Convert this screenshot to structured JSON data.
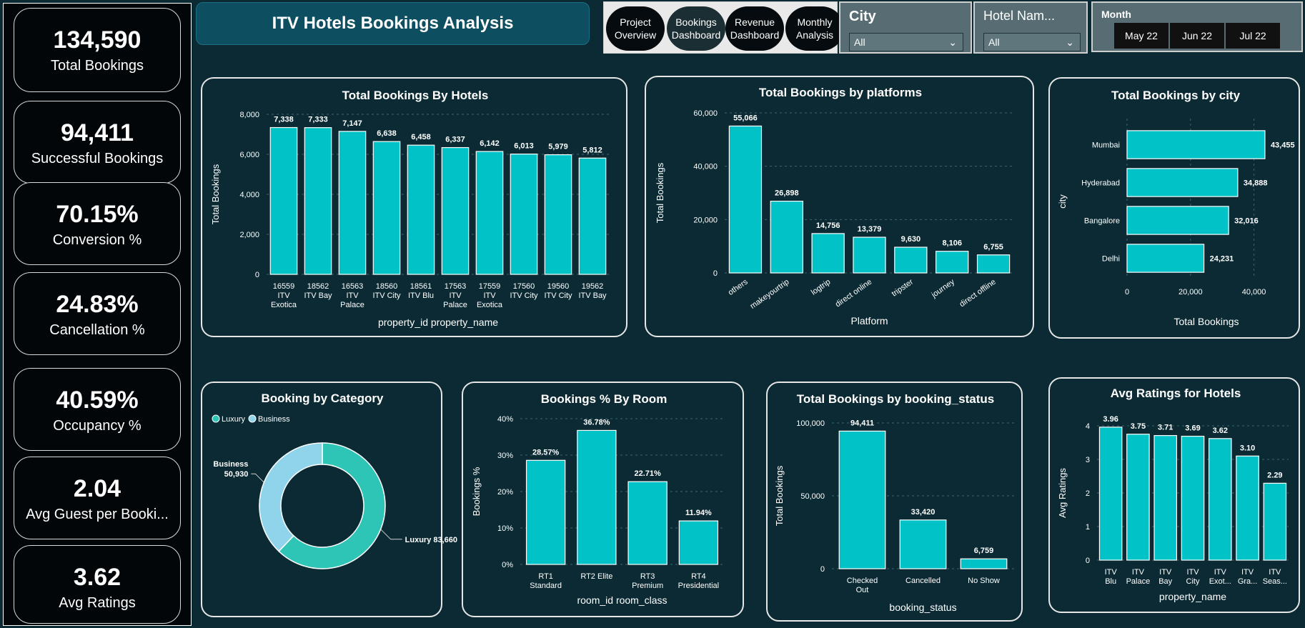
{
  "kpis": [
    {
      "value": "134,590",
      "label": "Total Bookings"
    },
    {
      "value": "94,411",
      "label": "Successful Bookings"
    },
    {
      "value": "70.15%",
      "label": "Conversion %"
    },
    {
      "value": "24.83%",
      "label": "Cancellation %"
    },
    {
      "value": "40.59%",
      "label": "Occupancy %"
    },
    {
      "value": "2.04",
      "label": "Avg Guest per Booki..."
    },
    {
      "value": "3.62",
      "label": "Avg Ratings"
    }
  ],
  "header": {
    "title": "ITV Hotels Bookings Analysis"
  },
  "nav": [
    {
      "line1": "Project",
      "line2": "Overview"
    },
    {
      "line1": "Bookings",
      "line2": "Dashboard"
    },
    {
      "line1": "Revenue",
      "line2": "Dashboard"
    },
    {
      "line1": "Monthly",
      "line2": "Analysis"
    }
  ],
  "filters": {
    "city": {
      "title": "City",
      "value": "All"
    },
    "hotel": {
      "title": "Hotel Nam...",
      "value": "All"
    },
    "month": {
      "title": "Month",
      "options": [
        "May 22",
        "Jun 22",
        "Jul 22"
      ]
    }
  },
  "colors": {
    "bar": "#00c2c7",
    "luxury": "#2ec4b6",
    "business": "#8fd4ea",
    "background": "#0b2a33"
  },
  "chart_data": [
    {
      "id": "hotels",
      "type": "bar",
      "title": "Total Bookings By Hotels",
      "xlabel": "property_id property_name",
      "ylabel": "Total Bookings",
      "ylim": [
        0,
        8000
      ],
      "yticks": [
        "0",
        "2,000",
        "4,000",
        "6,000",
        "8,000"
      ],
      "categories": [
        [
          "16559",
          "ITV",
          "Exotica"
        ],
        [
          "18562",
          "ITV Bay"
        ],
        [
          "16563",
          "ITV",
          "Palace"
        ],
        [
          "18560",
          "ITV City"
        ],
        [
          "18561",
          "ITV Blu"
        ],
        [
          "17563",
          "ITV",
          "Palace"
        ],
        [
          "17559",
          "ITV",
          "Exotica"
        ],
        [
          "17560",
          "ITV City"
        ],
        [
          "19560",
          "ITV City"
        ],
        [
          "19562",
          "ITV Bay"
        ]
      ],
      "values": [
        7338,
        7333,
        7147,
        6638,
        6458,
        6337,
        6142,
        6013,
        5979,
        5812
      ],
      "labels": [
        "7,338",
        "7,333",
        "7,147",
        "6,638",
        "6,458",
        "6,337",
        "6,142",
        "6,013",
        "5,979",
        "5,812"
      ]
    },
    {
      "id": "platforms",
      "type": "bar",
      "title": "Total Bookings by platforms",
      "xlabel": "Platform",
      "ylabel": "Total Bookings",
      "ylim": [
        0,
        60000
      ],
      "yticks": [
        "0",
        "20,000",
        "40,000",
        "60,000"
      ],
      "categories": [
        "others",
        "makeyourtrip",
        "logtrip",
        "direct online",
        "tripster",
        "journey",
        "direct offline"
      ],
      "values": [
        55066,
        26898,
        14756,
        13379,
        9630,
        8106,
        6755
      ],
      "labels": [
        "55,066",
        "26,898",
        "14,756",
        "13,379",
        "9,630",
        "8,106",
        "6,755"
      ]
    },
    {
      "id": "city",
      "type": "bar",
      "orientation": "horizontal",
      "title": "Total Bookings by city",
      "xlabel": "Total Bookings",
      "ylabel": "city",
      "xlim": [
        0,
        50000
      ],
      "xticks": [
        "0",
        "20,000",
        "40,000"
      ],
      "categories": [
        "Mumbai",
        "Hyderabad",
        "Bangalore",
        "Delhi"
      ],
      "values": [
        43455,
        34888,
        32016,
        24231
      ],
      "labels": [
        "43,455",
        "34,888",
        "32,016",
        "24,231"
      ]
    },
    {
      "id": "category",
      "type": "pie",
      "title": "Booking by Category",
      "legend": [
        "Luxury",
        "Business"
      ],
      "categories": [
        "Luxury",
        "Business"
      ],
      "values": [
        83660,
        50930
      ],
      "labels": [
        "Luxury 83,660",
        "Business",
        "50,930"
      ]
    },
    {
      "id": "room",
      "type": "bar",
      "title": "Bookings % By Room",
      "xlabel": "room_id room_class",
      "ylabel": "Bookings %",
      "ylim": [
        0,
        40
      ],
      "yticks": [
        "0%",
        "10%",
        "20%",
        "30%",
        "40%"
      ],
      "categories": [
        [
          "RT1",
          "Standard"
        ],
        [
          "RT2 Elite"
        ],
        [
          "RT3",
          "Premium"
        ],
        [
          "RT4",
          "Presidential"
        ]
      ],
      "values": [
        28.57,
        36.78,
        22.71,
        11.94
      ],
      "labels": [
        "28.57%",
        "36.78%",
        "22.71%",
        "11.94%"
      ]
    },
    {
      "id": "status",
      "type": "bar",
      "title": "Total Bookings by booking_status",
      "xlabel": "booking_status",
      "ylabel": "Total Bookings",
      "ylim": [
        0,
        100000
      ],
      "yticks": [
        "0",
        "50,000",
        "100,000"
      ],
      "categories": [
        [
          "Checked",
          "Out"
        ],
        [
          "Cancelled"
        ],
        [
          "No Show"
        ]
      ],
      "values": [
        94411,
        33420,
        6759
      ],
      "labels": [
        "94,411",
        "33,420",
        "6,759"
      ]
    },
    {
      "id": "ratings",
      "type": "bar",
      "title": "Avg Ratings for Hotels",
      "xlabel": "property_name",
      "ylabel": "Avg Ratings",
      "ylim": [
        0,
        4
      ],
      "yticks": [
        "0",
        "1",
        "2",
        "3",
        "4"
      ],
      "categories": [
        [
          "ITV",
          "Blu"
        ],
        [
          "ITV",
          "Palace"
        ],
        [
          "ITV",
          "Bay"
        ],
        [
          "ITV",
          "City"
        ],
        [
          "ITV",
          "Exot..."
        ],
        [
          "ITV",
          "Gra..."
        ],
        [
          "ITV",
          "Seas..."
        ]
      ],
      "values": [
        3.96,
        3.75,
        3.71,
        3.69,
        3.62,
        3.1,
        2.29
      ],
      "labels": [
        "3.96",
        "3.75",
        "3.71",
        "3.69",
        "3.62",
        "3.10",
        "2.29"
      ]
    }
  ]
}
